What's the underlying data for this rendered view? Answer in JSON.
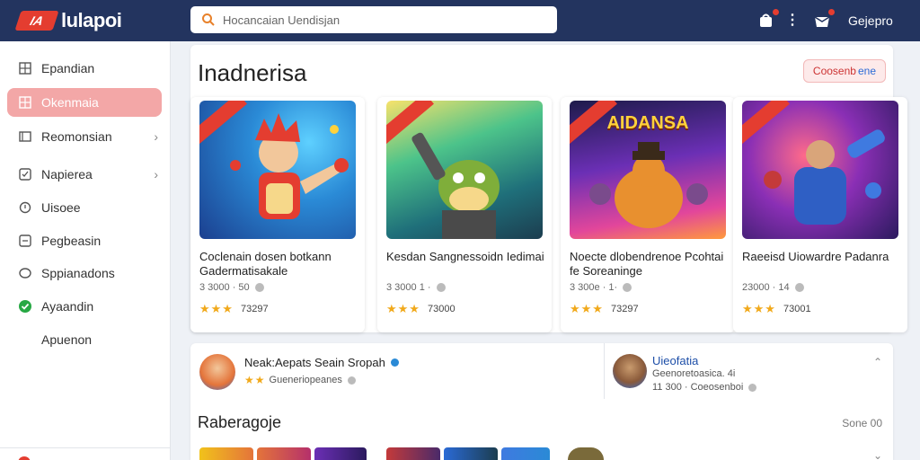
{
  "brand": {
    "logo_mark": "IA",
    "logo_text": "lulapoi"
  },
  "search": {
    "placeholder": "Hocancaian Uendisjan"
  },
  "topbar": {
    "user_label": "Gejepro"
  },
  "sidebar": {
    "items": [
      {
        "label": "Epandian",
        "icon": "grid-icon"
      },
      {
        "label": "Okenmaia",
        "icon": "grid-icon",
        "active": true
      },
      {
        "label": "Reomonsian",
        "icon": "library-icon",
        "chevron": true
      },
      {
        "label": "Napierea",
        "icon": "checkbox-icon",
        "chevron": true
      },
      {
        "label": "Uisoee",
        "icon": "circle-icon"
      },
      {
        "label": "Pegbeasin",
        "icon": "checkbox-icon"
      },
      {
        "label": "Sppianadons",
        "icon": "bubble-icon"
      },
      {
        "label": "Ayaandin",
        "icon": "check-icon"
      },
      {
        "label": "Apuenon",
        "icon": ""
      }
    ]
  },
  "main": {
    "title": "Inadnerisa",
    "see_button": {
      "part1": "Coosenb",
      "part2": "ene"
    },
    "games": [
      {
        "title": "Coclenain dosen botkann Gadermatisakale",
        "meta": "3 3000 · 50",
        "rating": "73297",
        "art_title": ""
      },
      {
        "title": "Kesdan Sangnessoidn Iedimai",
        "meta": "3 3000 1 ·",
        "rating": "73000",
        "art_title": ""
      },
      {
        "title": "Noecte dlobendrenoe Pcohtai fe Soreaninge",
        "meta": "3 300e · 1·",
        "rating": "73297",
        "art_title": "AIDANSA"
      },
      {
        "title": "Raeeisd Uiowardre Padanra",
        "meta": "23000 · 14",
        "rating": "73001",
        "art_title": ""
      }
    ]
  },
  "card2": {
    "left": {
      "name": "Neak:Aepats Seain Sropah",
      "sub": "Gueneriopeanes"
    },
    "right": {
      "name": "Uieofatia",
      "sub1": "Geenoretoasica. 4i",
      "sub2": "11 300 · Coeosenboi"
    },
    "section_title": "Raberagoje",
    "see_all": "Sone 00"
  },
  "colors": {
    "topbar": "#23345f",
    "accent_red": "#e43d30",
    "active_item": "#f3a7a7",
    "star": "#f1a91b",
    "verified": "#2a8ad6"
  }
}
